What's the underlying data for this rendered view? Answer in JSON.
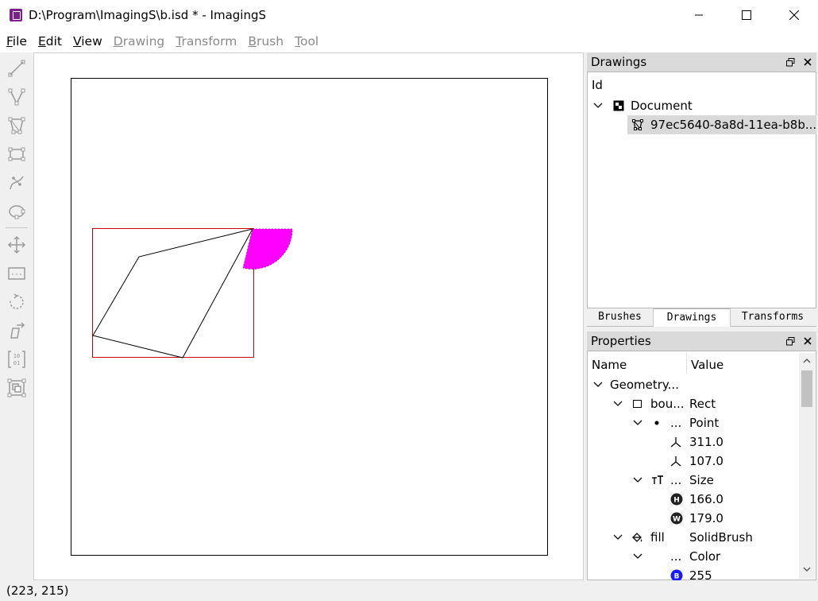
{
  "window": {
    "title": "D:\\Program\\ImagingS\\b.isd * - ImagingS"
  },
  "menu": [
    {
      "label": "File",
      "ul": "F",
      "rest": "ile",
      "enabled": true
    },
    {
      "label": "Edit",
      "ul": "E",
      "rest": "dit",
      "enabled": true
    },
    {
      "label": "View",
      "ul": "V",
      "rest": "iew",
      "enabled": true
    },
    {
      "label": "Drawing",
      "ul": "D",
      "rest": "rawing",
      "enabled": false
    },
    {
      "label": "Transform",
      "ul": "T",
      "rest": "ransform",
      "enabled": false
    },
    {
      "label": "Brush",
      "ul": "B",
      "rest": "rush",
      "enabled": false
    },
    {
      "label": "Tool",
      "ul": "T",
      "rest": "ool",
      "enabled": false
    }
  ],
  "toolbar": {
    "tools": [
      "line-tool-icon",
      "polyline-tool-icon",
      "polygon-tool-icon",
      "rectangle-tool-icon",
      "curve-tool-icon",
      "ellipse-tool-icon",
      "move-tool-icon",
      "clip-tool-icon",
      "rotate-tool-icon",
      "skew-tool-icon",
      "matrix-tool-icon",
      "bounds-tool-icon"
    ]
  },
  "status": {
    "coords": "(223, 215)"
  },
  "drawings_dock": {
    "title": "Drawings",
    "column": "Id",
    "root": "Document",
    "child": "97ec5640-8a8d-11ea-b8b..."
  },
  "tabs": [
    "Brushes",
    "Drawings",
    "Transforms"
  ],
  "active_tab": "Drawings",
  "properties_dock": {
    "title": "Properties",
    "col_name": "Name",
    "col_value": "Value",
    "rows": [
      {
        "name": "Geometry...",
        "value": ""
      },
      {
        "name": "bou...",
        "value": "Rect"
      },
      {
        "name": "...",
        "value": "Point"
      },
      {
        "name": "",
        "value": "311.0"
      },
      {
        "name": "",
        "value": "107.0"
      },
      {
        "name": "...",
        "value": "Size"
      },
      {
        "name": "",
        "value": "166.0"
      },
      {
        "name": "",
        "value": "179.0"
      },
      {
        "name": "fill",
        "value": "SolidBrush"
      },
      {
        "name": "...",
        "value": "Color"
      },
      {
        "name": "",
        "value": "255"
      }
    ]
  },
  "colors": {
    "accent": "#7a1f8c",
    "fill_shape": "#ff00ff",
    "bounds": "#cc0000",
    "selected_row": "#d9d9d9"
  }
}
